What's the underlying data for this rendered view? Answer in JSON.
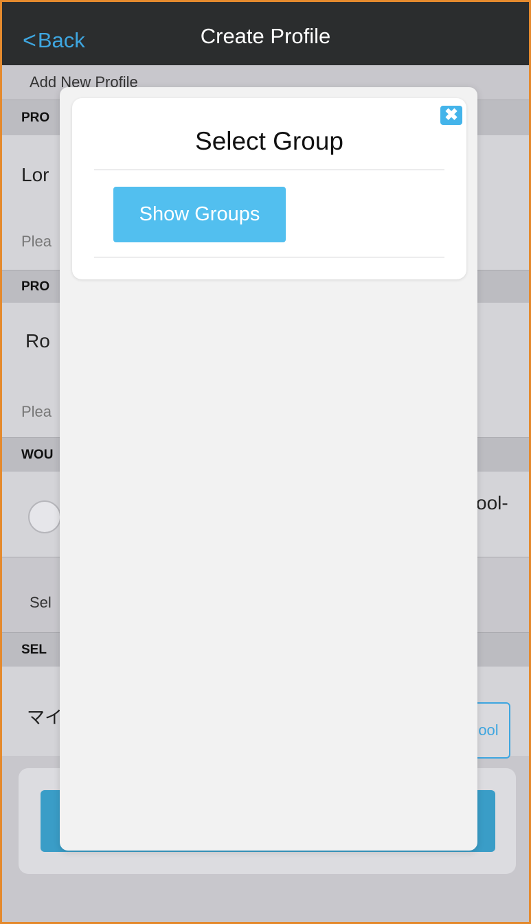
{
  "navbar": {
    "back_label": "Back",
    "back_chevron": "<",
    "title": "Create Profile"
  },
  "background": {
    "subtitle": "Add New Profile",
    "section1_header": "PRO",
    "section1_value": "Lor",
    "section1_hint": "Plea",
    "section2_header": "PRO",
    "section2_value": "Ro",
    "section2_hint": "Plea",
    "section3_header": "WOU",
    "section3_right_text": "ool-",
    "select_label": "Sel",
    "section4_header": "SEL",
    "section4_value": "マイ",
    "tool_button_label": "ool"
  },
  "modal": {
    "title": "Select Group",
    "close_icon": "close-icon",
    "close_glyph": "✖",
    "show_groups_label": "Show Groups"
  },
  "colors": {
    "accent": "#3ea6e0",
    "navbar": "#2b2d2e",
    "show_groups_button": "#52bfef",
    "frame_border": "#e48a2e"
  }
}
